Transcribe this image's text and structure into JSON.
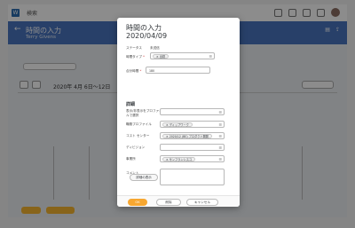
{
  "app": {
    "search_label": "検索",
    "header_title": "時間の入力",
    "header_name": "Terry Givens",
    "date_range": "2020年 4月 6日〜12日"
  },
  "dialog": {
    "title": "時間の入力",
    "date": "2020/04/09",
    "status_label": "ステータス",
    "status_value": "未送信",
    "time_type_label": "時間タイプ",
    "time_type_value": "出勤",
    "hours_label": "合計時間",
    "hours_value": "180",
    "details_header": "詳細",
    "rule_label": "表示/非表示をプロファイルで選択",
    "job_profile_label": "職務プロファイル",
    "job_profile_value": "ディップワーク",
    "cost_center_label": "コスト センター",
    "cost_center_value": "2020/12 (BE) プロダクト開発",
    "division_label": "ディビジョン",
    "business_unit_label": "事業所",
    "business_unit_value": "サンフランシスコ",
    "comment_label": "コメント",
    "details_button": "詳細の表示",
    "ok_button": "OK",
    "delete_button": "削除",
    "cancel_button": "キャンセル"
  },
  "colors": {
    "header": "#4a76c0",
    "accent": "#f7a731"
  }
}
